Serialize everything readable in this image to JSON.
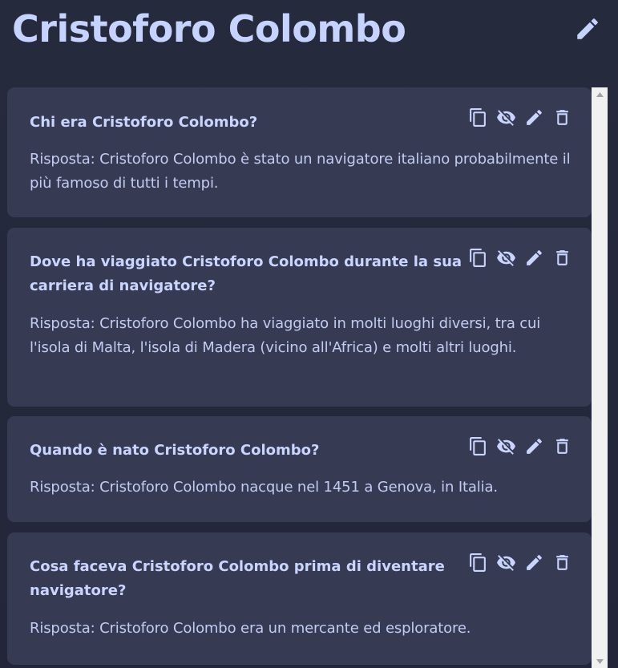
{
  "header": {
    "title": "Cristoforo Colombo",
    "edit_icon": "pencil-icon"
  },
  "colors": {
    "background": "#262a3d",
    "card": "#363a53",
    "accent": "#c6d2ff",
    "text": "#c2ccf2"
  },
  "card_actions": [
    {
      "name": "copy",
      "icon": "copy-icon"
    },
    {
      "name": "hide",
      "icon": "eye-off-icon"
    },
    {
      "name": "edit",
      "icon": "pencil-icon"
    },
    {
      "name": "delete",
      "icon": "trash-icon"
    }
  ],
  "cards": [
    {
      "question": "Chi era Cristoforo Colombo?",
      "answer": "Risposta: Cristoforo Colombo è stato un navigatore italiano probabilmente il più famoso di tutti i tempi."
    },
    {
      "question": "Dove ha viaggiato Cristoforo Colombo durante la sua carriera di navigatore?",
      "answer": "Risposta: Cristoforo Colombo ha viaggiato in molti luoghi diversi, tra cui l'isola di Malta, l'isola di Madera (vicino all'Africa) e molti altri luoghi."
    },
    {
      "question": "Quando è nato Cristoforo Colombo?",
      "answer": "Risposta: Cristoforo Colombo nacque nel 1451 a Genova, in Italia."
    },
    {
      "question": "Cosa faceva Cristoforo Colombo prima di diventare navigatore?",
      "answer": "Risposta: Cristoforo Colombo era un mercante ed esploratore."
    }
  ]
}
